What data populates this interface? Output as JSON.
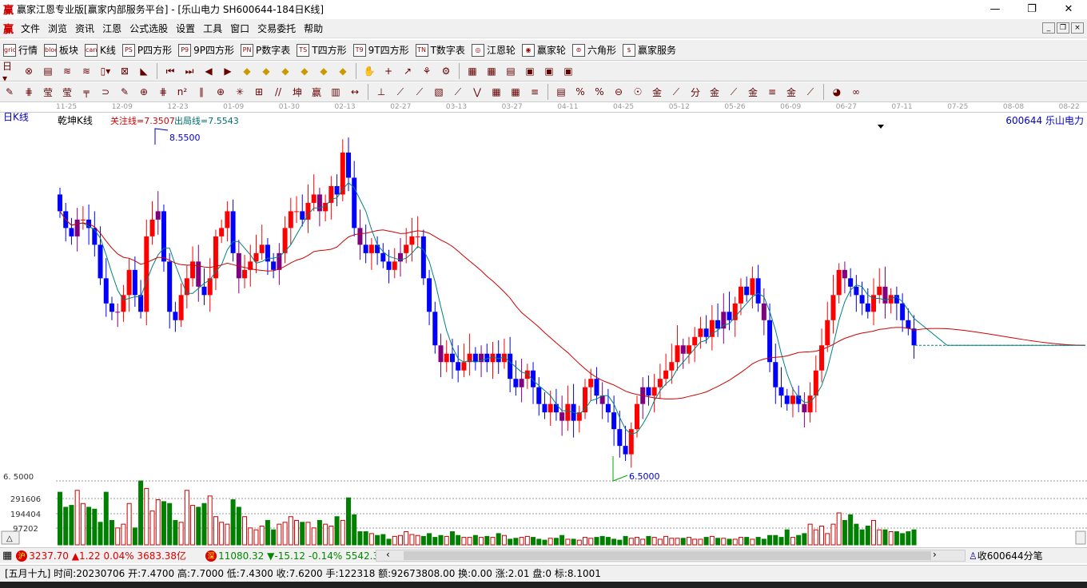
{
  "title": "赢家江恩专业版[赢家内部服务平台] - [乐山电力  SH600644-184日K线]",
  "logo": "赢",
  "window_buttons": {
    "minimize": "—",
    "restore": "❐",
    "close": "✕"
  },
  "menu": [
    "文件",
    "浏览",
    "资讯",
    "江恩",
    "公式选股",
    "设置",
    "工具",
    "窗口",
    "交易委托",
    "帮助"
  ],
  "toolbar1": [
    {
      "icon": "grid",
      "label": "行情"
    },
    {
      "icon": "blocks",
      "label": "板块"
    },
    {
      "icon": "candles",
      "label": "K线"
    },
    {
      "icon": "PS",
      "label": "P四方形"
    },
    {
      "icon": "P9",
      "label": "9P四方形"
    },
    {
      "icon": "PN",
      "label": "P数字表"
    },
    {
      "icon": "TS",
      "label": "T四方形"
    },
    {
      "icon": "T9",
      "label": "9T四方形"
    },
    {
      "icon": "TN",
      "label": "T数字表"
    },
    {
      "icon": "◎",
      "label": "江恩轮"
    },
    {
      "icon": "◉",
      "label": "赢家轮"
    },
    {
      "icon": "⊚",
      "label": "六角形"
    },
    {
      "icon": "$",
      "label": "赢家服务"
    }
  ],
  "toolbar2_icons": [
    "日▾",
    "⊗",
    "▤",
    "≋",
    "≋",
    "▯▾",
    "⊠",
    "◣",
    "⏮",
    "⏭",
    "◀",
    "▶",
    "◆",
    "◆",
    "◆",
    "◆",
    "◆",
    "◆",
    "✋",
    "+",
    "↗",
    "⚘",
    "⚙",
    "▦",
    "▦",
    "▤",
    "▣",
    "▣",
    "▣"
  ],
  "toolbar3_icons": [
    "✎",
    "⋕",
    "莹",
    "莹",
    "╤",
    "⊃",
    "✎",
    "⊕",
    "⋕",
    "n²",
    "∥",
    "⊕",
    "✳",
    "⊞",
    "//",
    "坤",
    "赢",
    "▥",
    "↔",
    "⊥",
    "⟋",
    "⟋",
    "▧",
    "⟋",
    "⋁",
    "▦",
    "▦",
    "≡",
    "▤",
    "%",
    "%",
    "⊖",
    "☉",
    "金",
    "⟋",
    "分",
    "金",
    "⟋",
    "金",
    "≡",
    "金",
    "⟋",
    "◕",
    "∞"
  ],
  "period_label": "日K线",
  "indicator": {
    "name": "乾坤K线",
    "focus_line": "关注线=7.3507",
    "exit_line": "出局线=7.5543"
  },
  "stock_label": "600644 乐山电力",
  "dates": [
    "11-25",
    "12-09",
    "12-23",
    "01-09",
    "01-30",
    "02-13",
    "02-27",
    "03-13",
    "03-27",
    "04-11",
    "04-25",
    "05-12",
    "05-26",
    "06-09",
    "06-27",
    "07-11",
    "07-25",
    "08-08",
    "08-22"
  ],
  "chart_data": {
    "type": "candlestick",
    "price_range": [
      6.5,
      8.55
    ],
    "max_label": "8.5500",
    "min_label": "6.5000",
    "axis_low_label": "6. 5000",
    "closes": [
      8.1,
      8.0,
      7.95,
      8.05,
      8.05,
      8.0,
      7.9,
      7.7,
      7.55,
      7.5,
      7.5,
      7.6,
      7.75,
      7.6,
      7.5,
      7.95,
      8.05,
      8.1,
      7.8,
      7.5,
      7.45,
      7.6,
      7.7,
      7.8,
      7.65,
      7.6,
      7.7,
      7.95,
      8.0,
      8.1,
      7.85,
      7.7,
      7.75,
      7.8,
      7.85,
      7.9,
      7.8,
      7.75,
      7.85,
      8.0,
      8.1,
      8.1,
      8.05,
      8.15,
      8.2,
      8.1,
      8.15,
      8.25,
      8.2,
      8.45,
      8.3,
      8.0,
      7.9,
      7.85,
      7.9,
      7.85,
      7.8,
      7.75,
      7.8,
      7.85,
      7.9,
      7.95,
      7.95,
      7.7,
      7.5,
      7.3,
      7.2,
      7.25,
      7.2,
      7.15,
      7.2,
      7.25,
      7.2,
      7.25,
      7.2,
      7.25,
      7.2,
      7.25,
      7.1,
      7.05,
      7.1,
      7.15,
      7.05,
      6.95,
      6.9,
      6.95,
      6.9,
      6.85,
      6.95,
      6.85,
      6.9,
      7.05,
      7.1,
      7.0,
      6.95,
      6.9,
      6.8,
      6.7,
      6.65,
      6.8,
      6.95,
      7.05,
      7.0,
      7.05,
      7.1,
      7.15,
      7.2,
      7.3,
      7.25,
      7.3,
      7.35,
      7.4,
      7.35,
      7.45,
      7.4,
      7.5,
      7.45,
      7.55,
      7.65,
      7.6,
      7.7,
      7.55,
      7.45,
      7.2,
      7.05,
      7.0,
      6.95,
      7.0,
      6.95,
      6.9,
      7.0,
      7.15,
      7.3,
      7.45,
      7.6,
      7.75,
      7.7,
      7.65,
      7.6,
      7.55,
      7.5,
      7.6,
      7.65,
      7.55,
      7.6,
      7.55,
      7.45,
      7.4,
      7.3
    ],
    "volume_ticks": [
      "291606",
      "194404",
      "97202"
    ],
    "volume_max": 340000,
    "volumes": [
      280,
      200,
      210,
      290,
      220,
      200,
      190,
      120,
      280,
      130,
      90,
      110,
      220,
      90,
      340,
      300,
      180,
      240,
      230,
      220,
      130,
      120,
      290,
      210,
      200,
      220,
      260,
      150,
      120,
      110,
      240,
      200,
      150,
      90,
      80,
      100,
      130,
      80,
      110,
      120,
      150,
      130,
      120,
      120,
      90,
      130,
      110,
      100,
      150,
      130,
      250,
      160,
      70,
      70,
      60,
      50,
      55,
      30,
      45,
      50,
      70,
      55,
      50,
      45,
      60,
      40,
      50,
      45,
      70,
      50,
      40,
      40,
      50,
      40,
      45,
      40,
      60,
      50,
      30,
      35,
      40,
      45,
      40,
      30,
      25,
      35,
      35,
      50,
      30,
      30,
      25,
      40,
      35,
      40,
      45,
      40,
      30,
      25,
      45,
      35,
      40,
      30,
      45,
      40,
      30,
      45,
      35,
      35,
      35,
      40,
      30,
      30,
      40,
      45,
      35,
      35,
      30,
      30,
      40,
      40,
      30,
      40,
      30,
      50,
      50,
      40,
      80,
      40,
      50,
      60,
      110,
      80,
      100,
      60,
      110,
      170,
      130,
      160,
      110,
      80,
      100,
      130,
      80,
      80,
      70,
      70,
      60,
      70,
      80
    ]
  },
  "status": {
    "sh_badge": "沪",
    "sh": "3237.70 ▲1.22 0.04% 3683.38亿",
    "sz_badge": "深",
    "sz": "11080.32 ▼-15.12 -0.14% 5542.38",
    "scroll_left": "‹",
    "scroll_right": "›",
    "collect": "收600644分笔"
  },
  "info": "[五月十九] 时间:20230706 开:7.4700 高:7.7000 低:7.4300 收:7.6200 手:122318 额:92673808.00 换:0.00 涨:2.01 盘:0 标:8.1001",
  "colors": {
    "up": "#ff0000",
    "down": "#0000ff",
    "mixed": "#800080",
    "ma_short": "#008080",
    "ma_long": "#cc0000",
    "vol_up": "#cc0000",
    "vol_down": "#008000"
  }
}
